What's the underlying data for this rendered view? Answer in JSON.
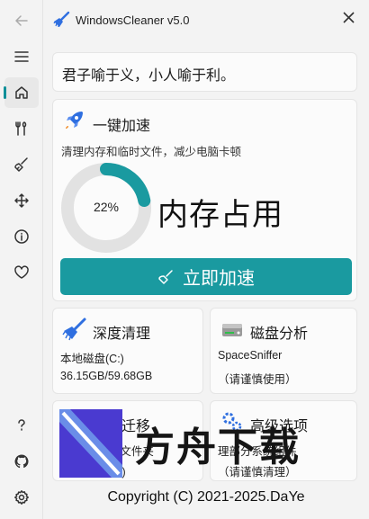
{
  "app": {
    "title": "WindowsCleaner v5.0"
  },
  "quote": "君子喻于义，小人喻于利。",
  "boost": {
    "title": "一键加速",
    "description": "清理内存和临时文件，减少电脑卡顿",
    "memory_percent_label": "22%",
    "memory_fraction": 0.22,
    "memory_label": "内存占用",
    "button_label": "立即加速"
  },
  "features": {
    "deep_clean": {
      "title": "深度清理",
      "line1": "本地磁盘(C:)",
      "line2": "36.15GB/59.68GB"
    },
    "disk_analysis": {
      "title": "磁盘分析",
      "line1": "SpaceSniffer",
      "line2": "（请谨慎使用）"
    },
    "data_move": {
      "title": "数据迁移",
      "line1": "ta文件夹",
      "line2": "理)"
    },
    "advanced": {
      "title": "高级选项",
      "line1": "理部分系统组件",
      "line2": "（请谨慎清理）"
    }
  },
  "footer": "Copyright (C) 2021-2025.DaYe",
  "watermark": {
    "text": "方舟下载"
  },
  "colors": {
    "accent": "#1a9aa0",
    "ring_track": "#e2e2e2",
    "icon_blue": "#2f6fe0"
  },
  "nav_icons": [
    "back-icon",
    "menu-icon",
    "home-icon",
    "tools-icon",
    "broom-icon",
    "move-icon",
    "info-icon",
    "heart-icon",
    "help-icon",
    "github-icon",
    "settings-icon"
  ]
}
